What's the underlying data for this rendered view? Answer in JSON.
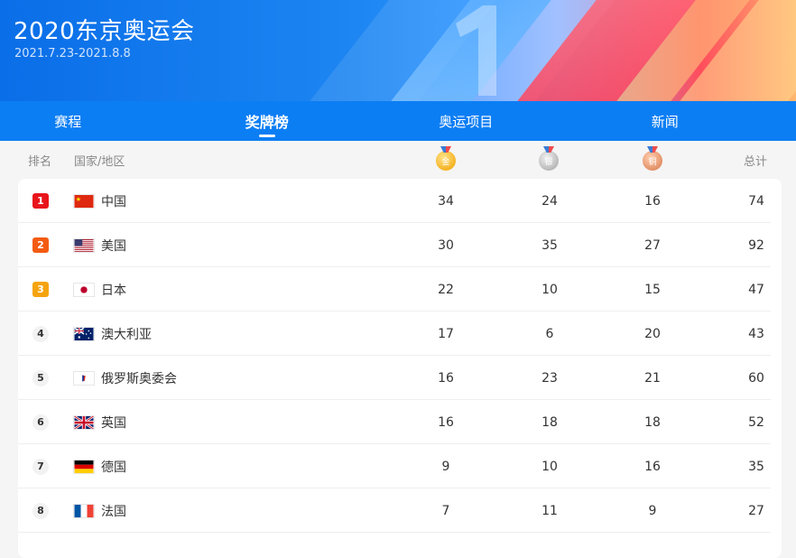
{
  "header": {
    "title": "2020东京奥运会",
    "dates": "2021.7.23-2021.8.8"
  },
  "tabs": [
    {
      "label": "赛程",
      "active": false
    },
    {
      "label": "奖牌榜",
      "active": true
    },
    {
      "label": "奥运项目",
      "active": false
    },
    {
      "label": "新闻",
      "active": false
    }
  ],
  "table": {
    "headers": {
      "rank": "排名",
      "country": "国家/地区",
      "gold_icon": "gold-medal-icon",
      "silver_icon": "silver-medal-icon",
      "bronze_icon": "bronze-medal-icon",
      "total": "总计"
    },
    "rows": [
      {
        "rank": "1",
        "country": "中国",
        "flag": "china-flag-icon",
        "gold": "34",
        "silver": "24",
        "bronze": "16",
        "total": "74"
      },
      {
        "rank": "2",
        "country": "美国",
        "flag": "usa-flag-icon",
        "gold": "30",
        "silver": "35",
        "bronze": "27",
        "total": "92"
      },
      {
        "rank": "3",
        "country": "日本",
        "flag": "japan-flag-icon",
        "gold": "22",
        "silver": "10",
        "bronze": "15",
        "total": "47"
      },
      {
        "rank": "4",
        "country": "澳大利亚",
        "flag": "australia-flag-icon",
        "gold": "17",
        "silver": "6",
        "bronze": "20",
        "total": "43"
      },
      {
        "rank": "5",
        "country": "俄罗斯奥委会",
        "flag": "roc-flag-icon",
        "gold": "16",
        "silver": "23",
        "bronze": "21",
        "total": "60"
      },
      {
        "rank": "6",
        "country": "英国",
        "flag": "uk-flag-icon",
        "gold": "16",
        "silver": "18",
        "bronze": "18",
        "total": "52"
      },
      {
        "rank": "7",
        "country": "德国",
        "flag": "germany-flag-icon",
        "gold": "9",
        "silver": "10",
        "bronze": "16",
        "total": "35"
      },
      {
        "rank": "8",
        "country": "法国",
        "flag": "france-flag-icon",
        "gold": "7",
        "silver": "11",
        "bronze": "9",
        "total": "27"
      }
    ]
  },
  "colors": {
    "primary": "#0c7ef4",
    "highlight": "#e8151c",
    "rank2": "#f35b12",
    "rank3": "#f5a40f"
  }
}
